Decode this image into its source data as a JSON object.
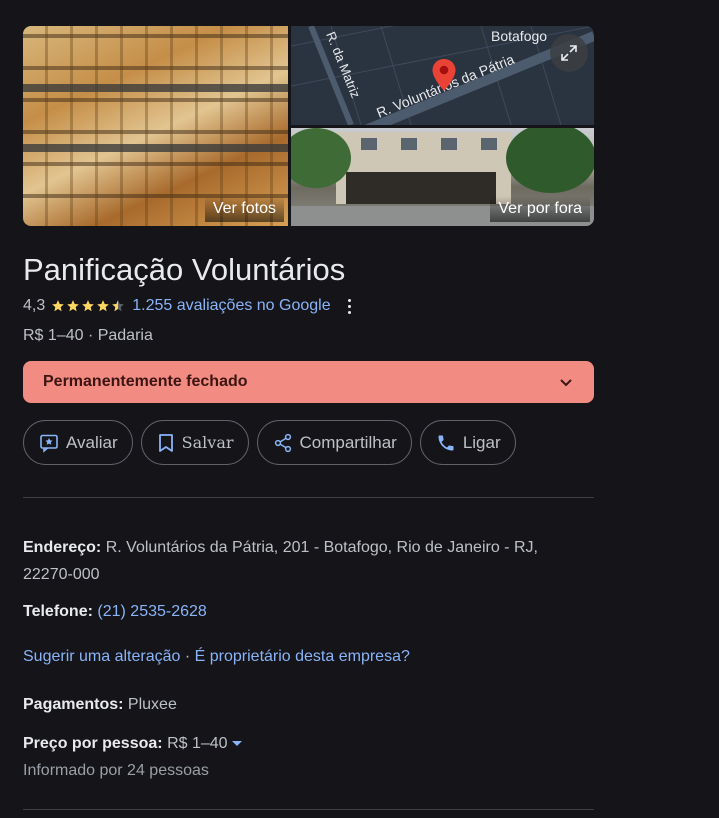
{
  "photos": {
    "main_label": "Ver fotos",
    "street_label": "Ver por fora",
    "map_labels": {
      "street_main": "R. Voluntários da Pátria",
      "street_side": "R. da Matriz",
      "district": "Botafogo"
    }
  },
  "place": {
    "name": "Panificação Voluntários",
    "rating": "4,3",
    "stars": 4.3,
    "reviews_link": "1.255 avaliações no Google",
    "price_category": "R$ 1–40 · Padaria"
  },
  "status": {
    "closed_label": "Permanentemente fechado"
  },
  "actions": {
    "review": "Avaliar",
    "save": "Salvar",
    "share": "Compartilhar",
    "call": "Ligar"
  },
  "info": {
    "address_label": "Endereço:",
    "address_line1": "R. Voluntários da Pátria, 201 - Botafogo, Rio de Janeiro - RJ,",
    "address_line2": "22270-000",
    "phone_label": "Telefone:",
    "phone_value": "(21) 2535-2628",
    "suggest_edit": "Sugerir uma alteração",
    "separator": " · ",
    "own_business": "É proprietário desta empresa?",
    "payments_label": "Pagamentos:",
    "payments_value": "Pluxee",
    "price_label": "Preço por pessoa:",
    "price_value": "R$ 1–40",
    "price_note": "Informado por 24 pessoas"
  },
  "colors": {
    "background": "#141419",
    "closed_banner": "#f28b82",
    "link": "#8ab4f8",
    "star": "#fdd663"
  },
  "icons": [
    "expand-icon",
    "map-pin-icon",
    "star-icon",
    "more-vert-icon",
    "chevron-down-icon",
    "review-icon",
    "bookmark-icon",
    "share-icon",
    "phone-icon"
  ]
}
